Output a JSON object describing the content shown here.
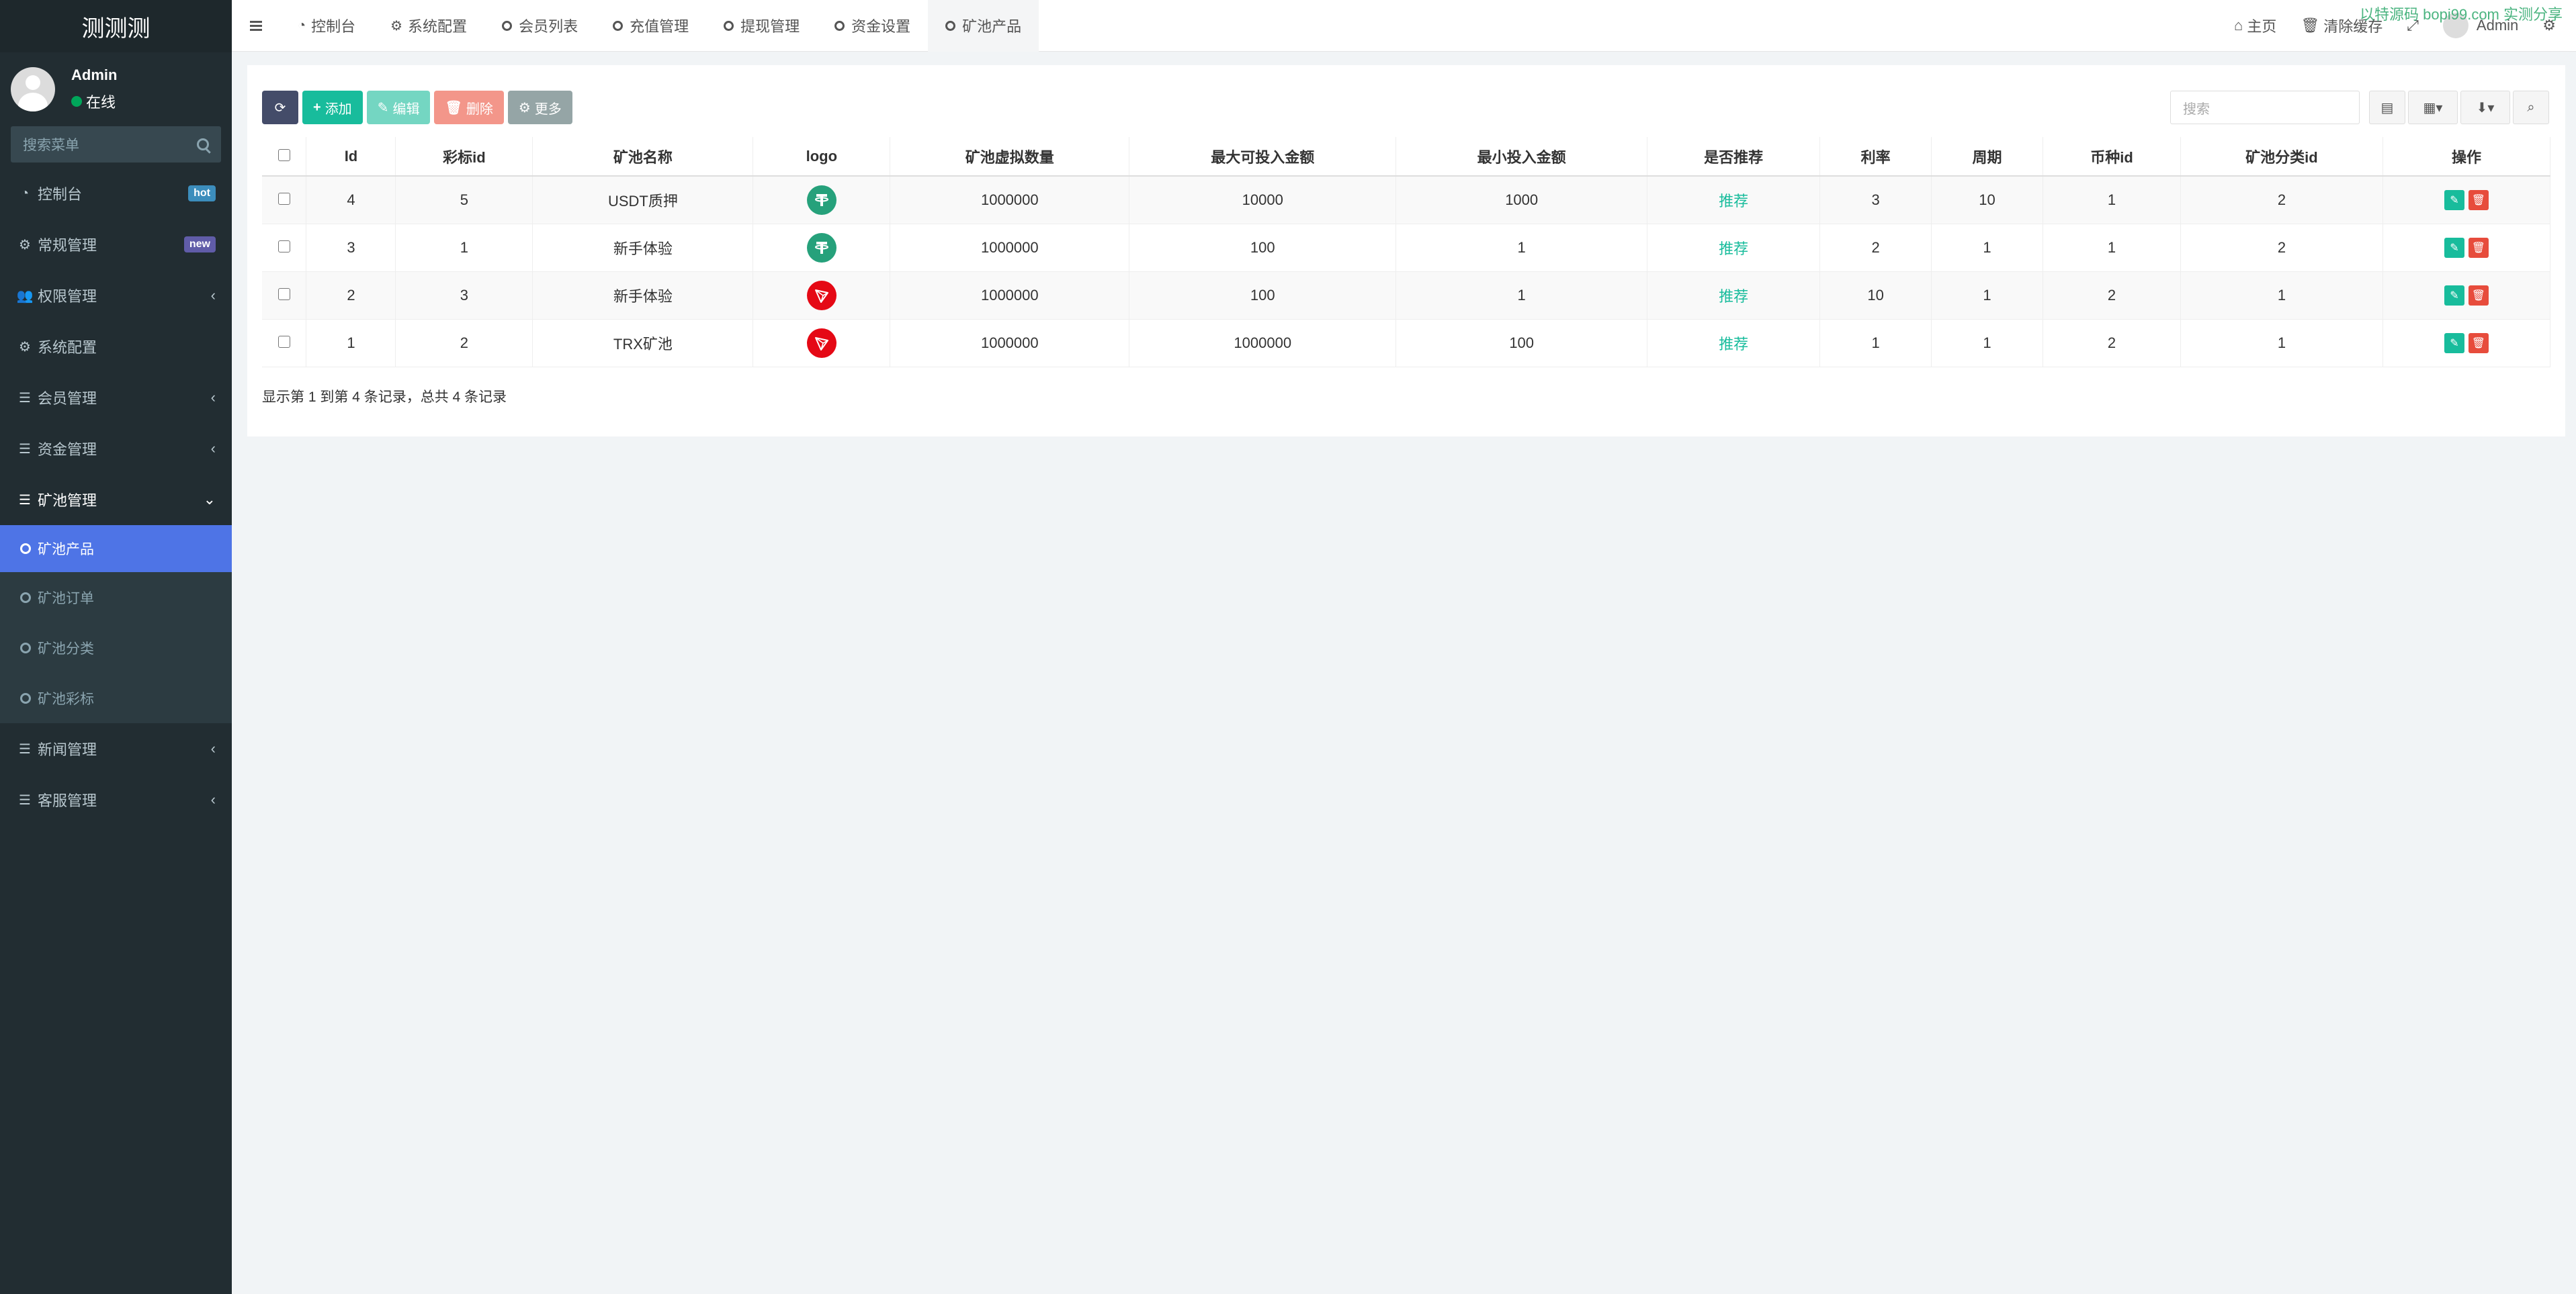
{
  "brand": "测测测",
  "user": {
    "name": "Admin",
    "status": "在线"
  },
  "sidebar": {
    "search_placeholder": "搜索菜单",
    "items": [
      {
        "label": "控制台",
        "badge": "hot"
      },
      {
        "label": "常规管理",
        "badge": "new"
      },
      {
        "label": "权限管理"
      },
      {
        "label": "系统配置"
      },
      {
        "label": "会员管理"
      },
      {
        "label": "资金管理"
      },
      {
        "label": "矿池管理"
      },
      {
        "label": "新闻管理"
      },
      {
        "label": "客服管理"
      }
    ],
    "sub_items": [
      "矿池产品",
      "矿池订单",
      "矿池分类",
      "矿池彩标"
    ]
  },
  "tabs": [
    "控制台",
    "系统配置",
    "会员列表",
    "充值管理",
    "提现管理",
    "资金设置",
    "矿池产品"
  ],
  "topbar": {
    "home": "主页",
    "clear_cache": "清除缓存",
    "admin": "Admin",
    "watermark": "以特源码 bopi99.com 实测分享"
  },
  "toolbar": {
    "add": "添加",
    "edit": "编辑",
    "delete": "删除",
    "more": "更多",
    "search_placeholder": "搜索"
  },
  "table": {
    "columns": [
      "Id",
      "彩标id",
      "矿池名称",
      "logo",
      "矿池虚拟数量",
      "最大可投入金额",
      "最小投入金额",
      "是否推荐",
      "利率",
      "周期",
      "币种id",
      "矿池分类id",
      "操作"
    ],
    "rows": [
      {
        "id": "4",
        "caibiao_id": "5",
        "name": "USDT质押",
        "logo": "usdt",
        "virtual_qty": "1000000",
        "max_amount": "10000",
        "min_amount": "1000",
        "recommend": "推荐",
        "rate": "3",
        "period": "10",
        "coin_id": "1",
        "category_id": "2"
      },
      {
        "id": "3",
        "caibiao_id": "1",
        "name": "新手体验",
        "logo": "usdt",
        "virtual_qty": "1000000",
        "max_amount": "100",
        "min_amount": "1",
        "recommend": "推荐",
        "rate": "2",
        "period": "1",
        "coin_id": "1",
        "category_id": "2"
      },
      {
        "id": "2",
        "caibiao_id": "3",
        "name": "新手体验",
        "logo": "trx",
        "virtual_qty": "1000000",
        "max_amount": "100",
        "min_amount": "1",
        "recommend": "推荐",
        "rate": "10",
        "period": "1",
        "coin_id": "2",
        "category_id": "1"
      },
      {
        "id": "1",
        "caibiao_id": "2",
        "name": "TRX矿池",
        "logo": "trx",
        "virtual_qty": "1000000",
        "max_amount": "1000000",
        "min_amount": "100",
        "recommend": "推荐",
        "rate": "1",
        "period": "1",
        "coin_id": "2",
        "category_id": "1"
      }
    ]
  },
  "footer_info": "显示第 1 到第 4 条记录，总共 4 条记录",
  "colors": {
    "sidebar_bg": "#222d32",
    "active_sub": "#4e74e6",
    "success": "#18bc9c",
    "danger": "#e74c3c"
  }
}
